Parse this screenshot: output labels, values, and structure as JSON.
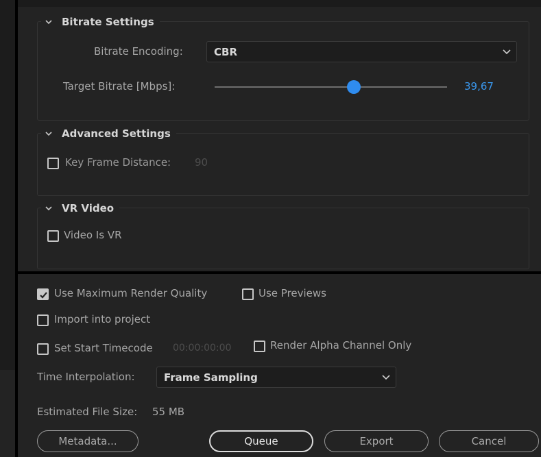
{
  "bitrate_settings": {
    "section_title": "Bitrate Settings",
    "encoding_label": "Bitrate Encoding:",
    "encoding_value": "CBR",
    "target_label": "Target Bitrate [Mbps]:",
    "target_value": "39,67",
    "target_fraction": 0.6
  },
  "advanced_settings": {
    "section_title": "Advanced Settings",
    "key_frame_label": "Key Frame Distance:",
    "key_frame_value": "90",
    "key_frame_checked": false
  },
  "vr_video": {
    "section_title": "VR Video",
    "video_is_vr_label": "Video Is VR",
    "video_is_vr_checked": false
  },
  "options": {
    "use_max_render_quality_label": "Use Maximum Render Quality",
    "use_max_render_quality_checked": true,
    "use_previews_label": "Use Previews",
    "use_previews_checked": false,
    "import_into_project_label": "Import into project",
    "import_into_project_checked": false,
    "set_start_timecode_label": "Set Start Timecode",
    "start_timecode_value": "00:00:00:00",
    "set_start_timecode_checked": false,
    "render_alpha_label": "Render Alpha Channel Only",
    "render_alpha_checked": false,
    "time_interpolation_label": "Time Interpolation:",
    "time_interpolation_value": "Frame Sampling",
    "estimated_size_label": "Estimated File Size:",
    "estimated_size_value": "55 MB"
  },
  "buttons": {
    "metadata": "Metadata...",
    "queue": "Queue",
    "export": "Export",
    "cancel": "Cancel"
  },
  "colors": {
    "background": "#232323",
    "accent": "#2f8cef",
    "value_text": "#3a98ef"
  }
}
